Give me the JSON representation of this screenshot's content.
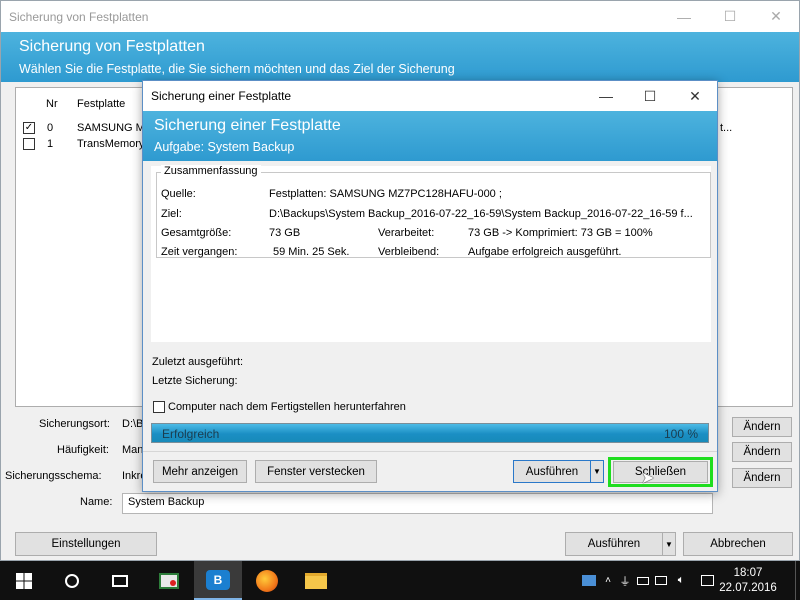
{
  "main_window": {
    "title": "Sicherung von Festplatten",
    "controls": {
      "minimize": "—",
      "maximize": "☐",
      "close": "✕"
    },
    "banner_title": "Sicherung von Festplatten",
    "banner_subtitle": "Wählen Sie die Festplatte, die Sie sichern möchten und das Ziel der Sicherung",
    "list_headers": {
      "nr": "Nr",
      "disk": "Festplatte"
    },
    "rows": [
      {
        "checked": "✓",
        "nr": "0",
        "disk": "SAMSUNG MZ",
        "tail": "t..."
      },
      {
        "checked": "",
        "nr": "1",
        "disk": "TransMemory"
      }
    ],
    "fields": [
      {
        "label": "Sicherungsort:",
        "value": "D:\\B",
        "button": "Ändern"
      },
      {
        "label": "Häufigkeit:",
        "value": "Man",
        "button": "Ändern"
      },
      {
        "label": "Sicherungsschema:",
        "value": "Inkre",
        "button": "Ändern"
      }
    ],
    "name_label": "Name:",
    "name_value": "System Backup",
    "settings_button": "Einstellungen",
    "run_button": "Ausführen",
    "cancel_button": "Abbrechen"
  },
  "dialog": {
    "title": "Sicherung einer Festplatte",
    "controls": {
      "minimize": "—",
      "maximize": "☐",
      "close": "✕"
    },
    "banner_title": "Sicherung einer Festplatte",
    "banner_subtitle": "Aufgabe: System Backup",
    "summary_legend": "Zusammenfassung",
    "source_label": "Quelle:",
    "source_value": "Festplatten: SAMSUNG MZ7PC128HAFU-000 ;",
    "target_label": "Ziel:",
    "target_value": "D:\\Backups\\System Backup_2016-07-22_16-59\\System Backup_2016-07-22_16-59   f...",
    "total_label": "Gesamtgröße:",
    "total_value": "73 GB",
    "processed_label": "Verarbeitet:",
    "processed_value": "73 GB -> Komprimiert: 73 GB = 100%",
    "elapsed_label": "Zeit vergangen:",
    "elapsed_value": "59 Min. 25 Sek.",
    "remaining_label": "Verbleibend:",
    "remaining_value": "Aufgabe erfolgreich ausgeführt.",
    "last_run_label": "Zuletzt ausgeführt:",
    "last_backup_label": "Letzte Sicherung:",
    "shutdown_label": "Computer nach dem Fertigstellen herunterfahren",
    "progress_status": "Erfolgreich",
    "progress_percent_text": "100 %",
    "progress_fraction": 1.0,
    "more_button": "Mehr anzeigen",
    "hide_button": "Fenster verstecken",
    "run_button": "Ausführen",
    "close_button": "Schließen"
  },
  "taskbar": {
    "start_icon": "windows-logo-icon",
    "apps": [
      "cortana-icon",
      "task-view-icon",
      "media-app-icon",
      "backup-app-icon",
      "firefox-icon",
      "file-explorer-icon"
    ],
    "backup_app_label": "B",
    "time": "18:07",
    "date": "22.07.2016"
  },
  "colors": {
    "banner": "#2e9ad0",
    "highlight": "#1fdd1f",
    "dialog_border": "#5c8fc6"
  }
}
